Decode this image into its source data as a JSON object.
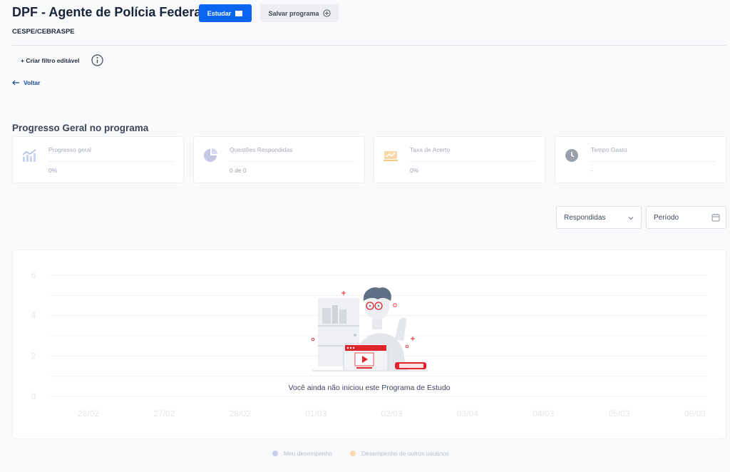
{
  "header": {
    "title": "DPF - Agente de Polícia Federal",
    "study_button": "Estudar",
    "save_button": "Salvar programa",
    "board": "CESPE/CEBRASPE"
  },
  "filters": {
    "create_filter": "+ Criar filtro editável",
    "back": "Voltar"
  },
  "progress": {
    "section_title": "Progresso Geral no programa",
    "cards": [
      {
        "label": "Progresso geral",
        "value": "0%",
        "icon": "trending-chart-icon"
      },
      {
        "label": "Questões Respondidas",
        "value": "0 de 0",
        "icon": "pie-chart-icon"
      },
      {
        "label": "Taxa de Acerto",
        "value": "0%",
        "icon": "accuracy-chart-icon"
      },
      {
        "label": "Tempo Gasto",
        "value": "-",
        "icon": "clock-icon"
      }
    ]
  },
  "controls": {
    "answered_select": "Respondidas",
    "period_placeholder": "Período"
  },
  "chart_data": {
    "type": "line",
    "categories": [
      "26/02",
      "27/02",
      "28/02",
      "01/03",
      "02/03",
      "03/04",
      "04/03",
      "05/03",
      "06/03"
    ],
    "y_ticks": [
      "6",
      "4",
      "2",
      "0"
    ],
    "ylim": [
      0,
      6
    ],
    "grid": true,
    "series": [
      {
        "name": "Meu desempenho",
        "values": [],
        "color": "#c8cde8"
      },
      {
        "name": "Desempenho de outros usuários",
        "values": [],
        "color": "#f9dbb0"
      }
    ],
    "empty_message": "Você ainda não iniciou este Programa de Estudo"
  },
  "colors": {
    "primary": "#0a66f2",
    "title": "#17243a",
    "accent_red": "#e0242b"
  }
}
